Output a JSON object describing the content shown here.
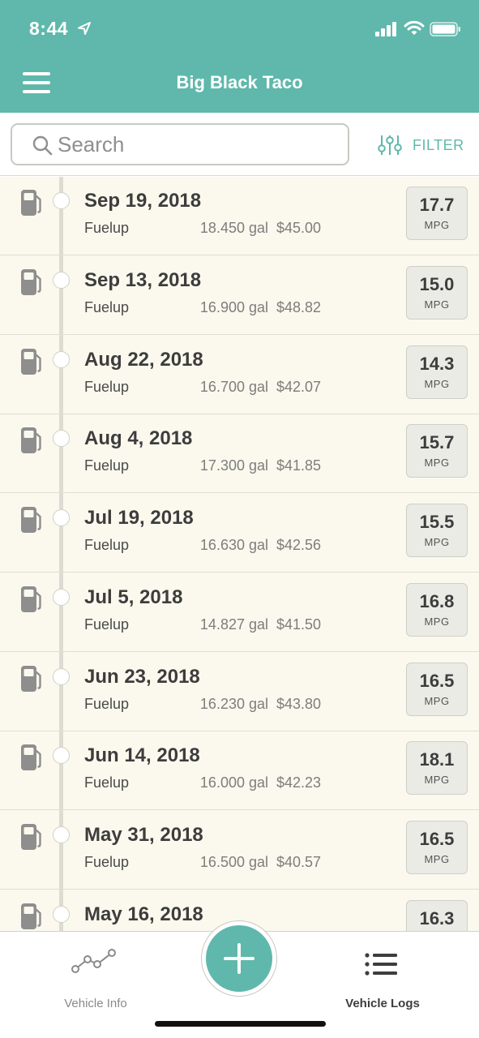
{
  "status_bar": {
    "time": "8:44"
  },
  "header": {
    "title": "Big Black Taco"
  },
  "search": {
    "placeholder": "Search",
    "filter_label": "FILTER"
  },
  "entries": [
    {
      "date": "Sep 19, 2018",
      "type": "Fuelup",
      "gallons": "18.450 gal",
      "cost": "$45.00",
      "mpg": "17.7",
      "unit": "MPG"
    },
    {
      "date": "Sep 13, 2018",
      "type": "Fuelup",
      "gallons": "16.900 gal",
      "cost": "$48.82",
      "mpg": "15.0",
      "unit": "MPG"
    },
    {
      "date": "Aug 22, 2018",
      "type": "Fuelup",
      "gallons": "16.700 gal",
      "cost": "$42.07",
      "mpg": "14.3",
      "unit": "MPG"
    },
    {
      "date": "Aug 4, 2018",
      "type": "Fuelup",
      "gallons": "17.300 gal",
      "cost": "$41.85",
      "mpg": "15.7",
      "unit": "MPG"
    },
    {
      "date": "Jul 19, 2018",
      "type": "Fuelup",
      "gallons": "16.630 gal",
      "cost": "$42.56",
      "mpg": "15.5",
      "unit": "MPG"
    },
    {
      "date": "Jul 5, 2018",
      "type": "Fuelup",
      "gallons": "14.827 gal",
      "cost": "$41.50",
      "mpg": "16.8",
      "unit": "MPG"
    },
    {
      "date": "Jun 23, 2018",
      "type": "Fuelup",
      "gallons": "16.230 gal",
      "cost": "$43.80",
      "mpg": "16.5",
      "unit": "MPG"
    },
    {
      "date": "Jun 14, 2018",
      "type": "Fuelup",
      "gallons": "16.000 gal",
      "cost": "$42.23",
      "mpg": "18.1",
      "unit": "MPG"
    },
    {
      "date": "May 31, 2018",
      "type": "Fuelup",
      "gallons": "16.500 gal",
      "cost": "$40.57",
      "mpg": "16.5",
      "unit": "MPG"
    },
    {
      "date": "May 16, 2018",
      "type": "",
      "gallons": "",
      "cost": "",
      "mpg": "16.3",
      "unit": ""
    }
  ],
  "tabbar": {
    "vehicle_info": "Vehicle Info",
    "vehicle_logs": "Vehicle Logs"
  },
  "colors": {
    "accent": "#5fb8ab",
    "list_bg": "#fbf9ee",
    "pump_icon": "#8e8e8e"
  },
  "icons": {
    "menu": "hamburger-icon",
    "search": "search-icon",
    "filter": "sliders-icon",
    "entry": "fuel-pump-icon",
    "vehicle_info": "line-chart-icon",
    "vehicle_logs": "list-icon",
    "add": "plus-icon"
  }
}
